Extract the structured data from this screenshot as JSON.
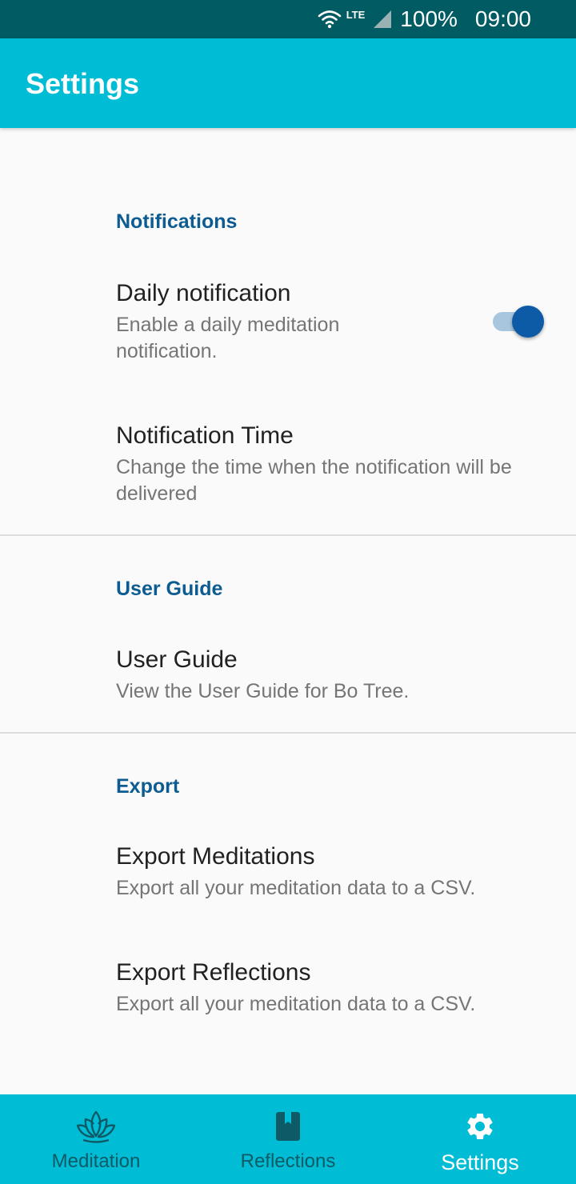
{
  "status_bar": {
    "network_label": "LTE",
    "battery": "100%",
    "time": "09:00",
    "icons": [
      "wifi-icon",
      "signal-icon"
    ]
  },
  "app_bar": {
    "title": "Settings"
  },
  "sections": {
    "notifications": {
      "header": "Notifications",
      "daily_notification": {
        "title": "Daily notification",
        "summary": "Enable a daily meditation notification.",
        "enabled": true
      },
      "notification_time": {
        "title": "Notification Time",
        "summary": "Change the time when the notification will be delivered"
      }
    },
    "user_guide": {
      "header": "User Guide",
      "item": {
        "title": "User Guide",
        "summary": "View the User Guide for Bo Tree."
      }
    },
    "export": {
      "header": "Export",
      "meditations": {
        "title": "Export Meditations",
        "summary": "Export all your meditation data to a CSV."
      },
      "reflections": {
        "title": "Export Reflections",
        "summary": "Export all your meditation data to a CSV."
      }
    }
  },
  "bottom_nav": {
    "items": [
      {
        "label": "Meditation",
        "icon": "lotus-icon",
        "active": false
      },
      {
        "label": "Reflections",
        "icon": "book-icon",
        "active": false
      },
      {
        "label": "Settings",
        "icon": "gear-icon",
        "active": true
      }
    ]
  },
  "colors": {
    "status_bar": "#005b63",
    "app_bar": "#00bcd4",
    "section_header": "#0d5c91",
    "switch_thumb": "#0d5aa7",
    "nav_inactive": "#0e5a66",
    "nav_active": "#ffffff"
  }
}
